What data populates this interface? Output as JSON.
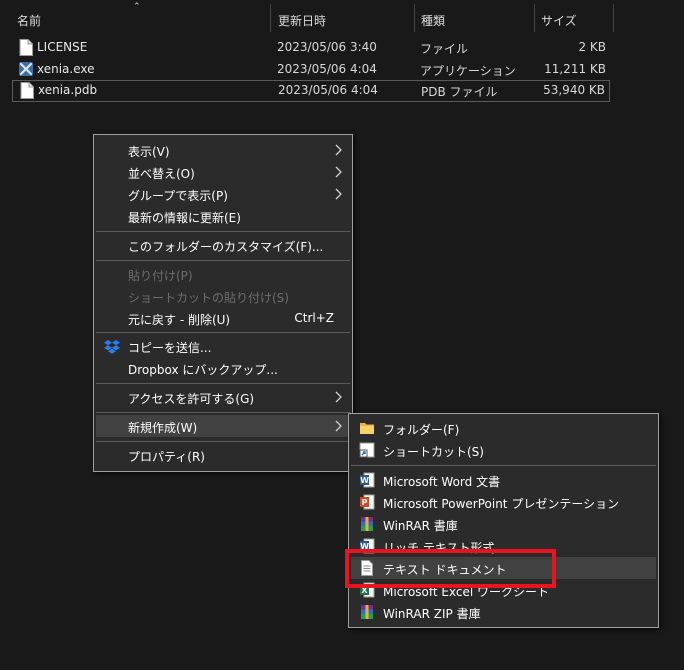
{
  "columns": {
    "name": "名前",
    "date": "更新日時",
    "type": "種類",
    "size": "サイズ"
  },
  "files": [
    {
      "name": "LICENSE",
      "date": "2023/05/06 3:40",
      "type": "ファイル",
      "size": "2 KB",
      "icon": "document-icon"
    },
    {
      "name": "xenia.exe",
      "date": "2023/05/06 4:04",
      "type": "アプリケーション",
      "size": "11,211 KB",
      "icon": "xenia-app-icon"
    },
    {
      "name": "xenia.pdb",
      "date": "2023/05/06 4:04",
      "type": "PDB ファイル",
      "size": "53,940 KB",
      "icon": "document-icon"
    }
  ],
  "context_menu": {
    "view": "表示(V)",
    "sort": "並べ替え(O)",
    "group": "グループで表示(P)",
    "refresh": "最新の情報に更新(E)",
    "customize": "このフォルダーのカスタマイズ(F)...",
    "paste": "貼り付け(P)",
    "paste_shortcut": "ショートカットの貼り付け(S)",
    "undo": "元に戻す - 削除(U)",
    "undo_shortcut": "Ctrl+Z",
    "copy_to": "コピーを送信...",
    "dropbox_backup": "Dropbox にバックアップ...",
    "give_access": "アクセスを許可する(G)",
    "new": "新規作成(W)",
    "properties": "プロパティ(R)"
  },
  "submenu": {
    "folder": "フォルダー(F)",
    "shortcut": "ショートカット(S)",
    "word": "Microsoft Word 文書",
    "powerpoint": "Microsoft PowerPoint プレゼンテーション",
    "winrar": "WinRAR 書庫",
    "rtf": "リッチ テキスト形式",
    "text": "テキスト ドキュメント",
    "excel": "Microsoft Excel ワークシート",
    "winrar_zip": "WinRAR ZIP 書庫"
  },
  "colors": {
    "highlight_box": "#e8141f",
    "menu_bg": "#2b2b2b",
    "window_bg": "#191919"
  }
}
